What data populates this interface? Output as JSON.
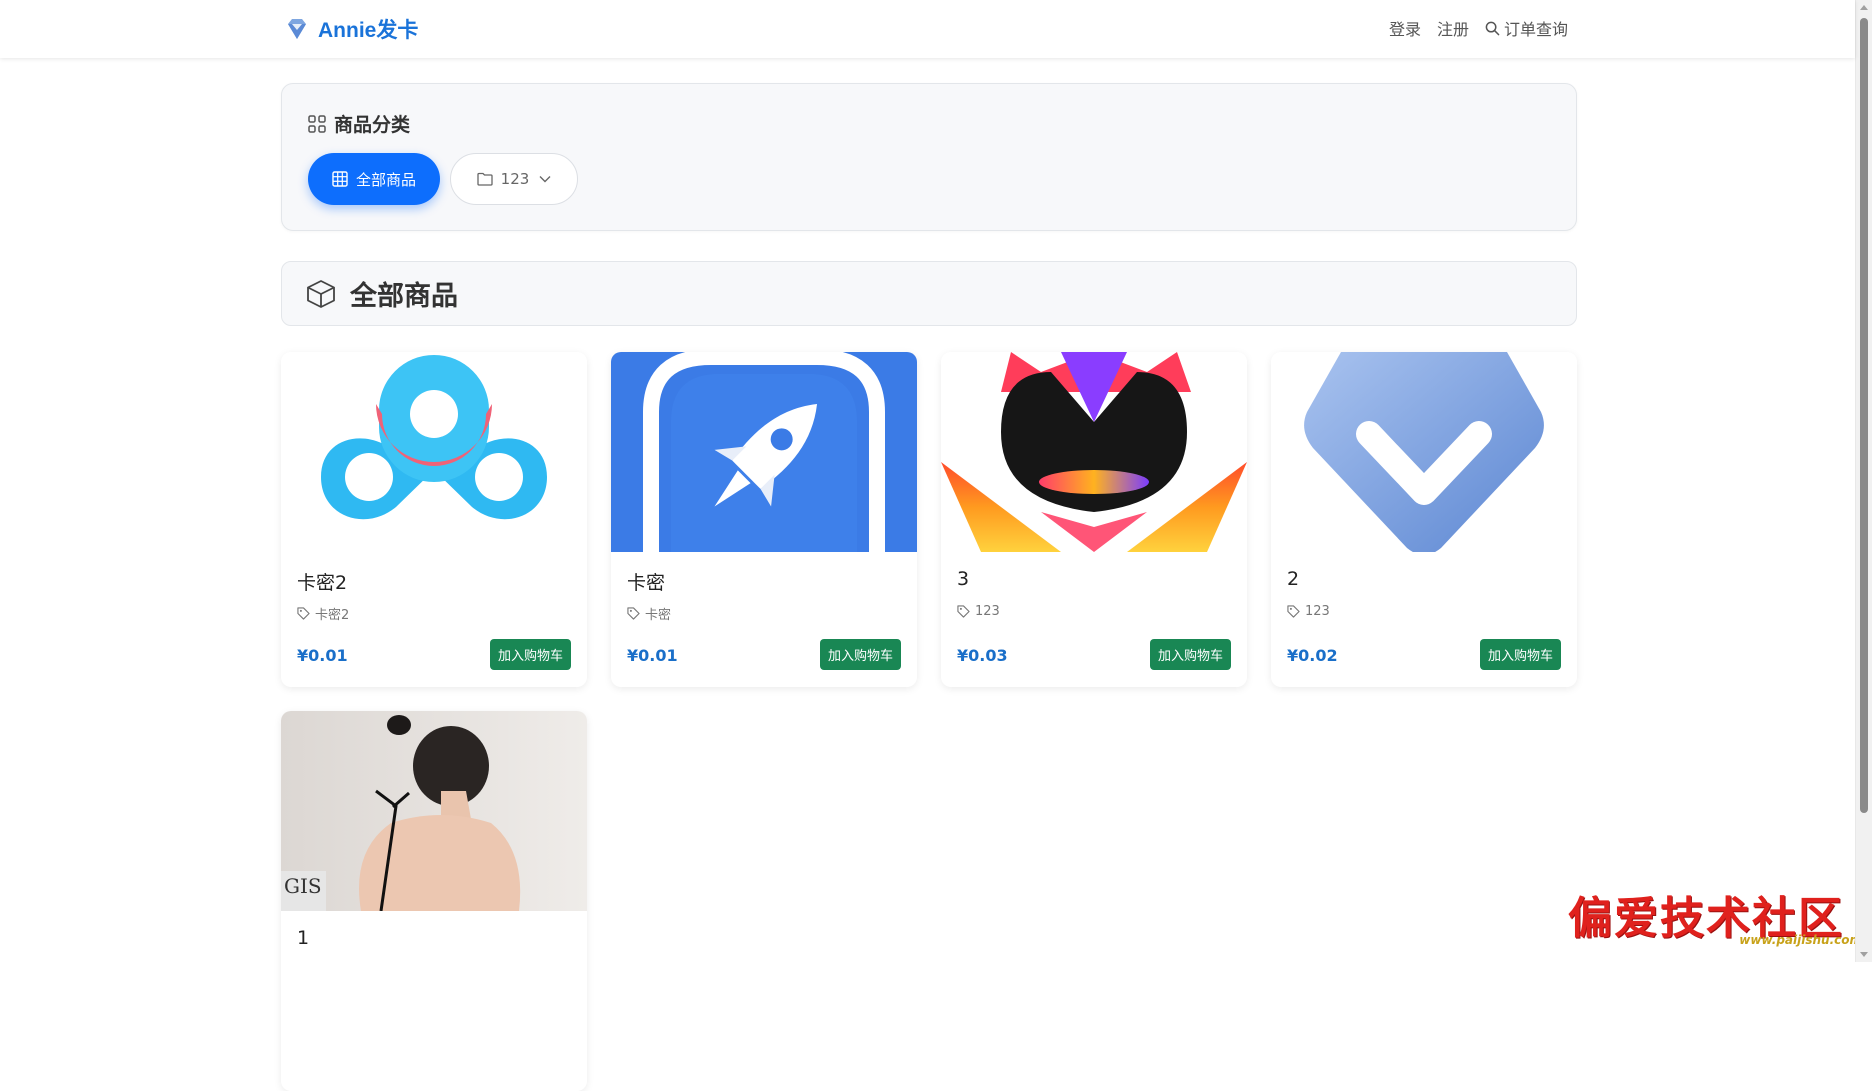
{
  "navbar": {
    "brand": "Annie发卡",
    "brand_icon": "diamond-icon",
    "links": {
      "login": "登录",
      "register": "注册",
      "order_query": "订单查询"
    }
  },
  "category_panel": {
    "title": "商品分类",
    "all_label": "全部商品",
    "category_label": "123"
  },
  "section": {
    "title": "全部商品"
  },
  "products": [
    {
      "name": "卡密2",
      "tag": "卡密2",
      "price": "¥0.01",
      "cart_label": "加入购物车",
      "image": "baidu-netdisk-logo"
    },
    {
      "name": "卡密",
      "tag": "卡密",
      "price": "¥0.01",
      "cart_label": "加入购物车",
      "image": "rocket-app-icon"
    },
    {
      "name": "3",
      "tag": "123",
      "price": "¥0.03",
      "cart_label": "加入购物车",
      "image": "flame-mask-logo"
    },
    {
      "name": "2",
      "tag": "123",
      "price": "¥0.02",
      "cart_label": "加入购物车",
      "image": "blue-v-badge-logo"
    },
    {
      "name": "1",
      "image": "photo-woman-back"
    }
  ],
  "watermark": {
    "text": "偏爱技术社区",
    "url": "www.paijishu.com"
  },
  "colors": {
    "brand": "#1a73d9",
    "primary": "#0d6efd",
    "success": "#198754",
    "price": "#1a6fc9"
  }
}
